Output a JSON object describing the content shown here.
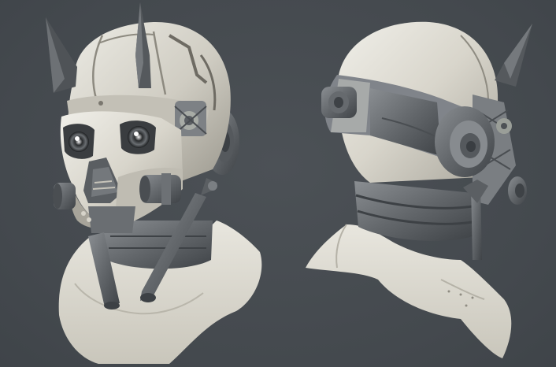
{
  "scene": {
    "background_color": "#464b50",
    "subject": [
      {
        "name": "helmet-front-three-quarter-view"
      },
      {
        "name": "helmet-rear-three-quarter-view"
      }
    ],
    "palette": {
      "shell_light": "#d9d6cc",
      "shell_mid": "#b8b5ab",
      "mechanical_dark": "#5d6166",
      "mechanical_mid": "#7a7e82",
      "collar_cloth": "#dedcd3"
    }
  }
}
